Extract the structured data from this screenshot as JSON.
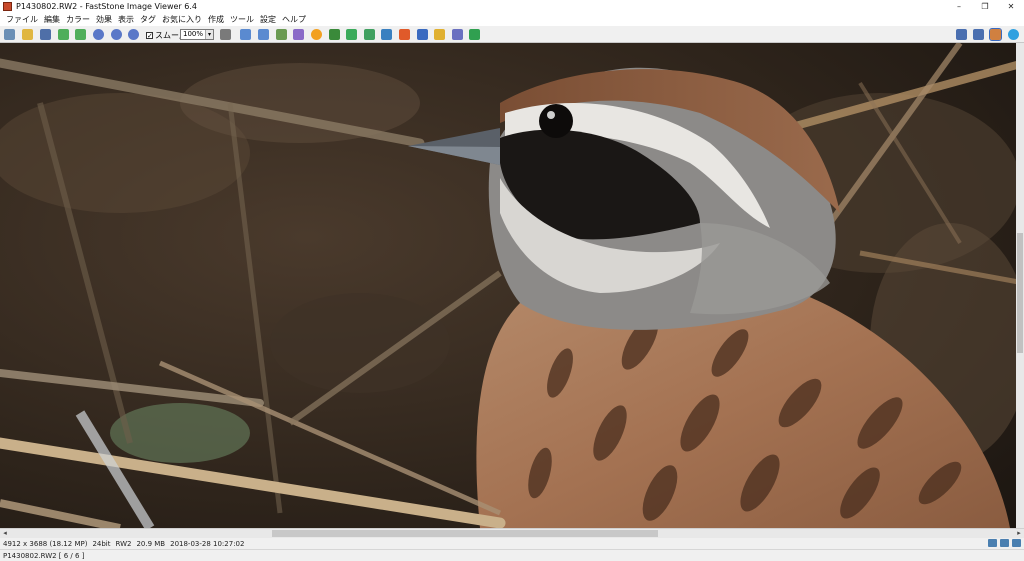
{
  "window": {
    "title": "P1430802.RW2 - FastStone Image Viewer 6.4",
    "minimize": "–",
    "restore": "❐",
    "close": "✕"
  },
  "menu": [
    "ファイル",
    "編集",
    "カラー",
    "効果",
    "表示",
    "タグ",
    "お気に入り",
    "作成",
    "ツール",
    "設定",
    "ヘルプ"
  ],
  "toolbar": {
    "smooth_label": "スムーズ",
    "smooth_checked": "✓",
    "zoom_value": "100%",
    "zoom_arrow": "▾",
    "left_icons": [
      {
        "name": "browser-icon",
        "color": "#6b8fb5"
      },
      {
        "name": "open-folder-icon",
        "color": "#e0b640"
      },
      {
        "name": "save-icon",
        "color": "#4f6fa8"
      },
      {
        "name": "previous-image-icon",
        "color": "#4fae5a"
      },
      {
        "name": "next-image-icon",
        "color": "#4fae5a"
      },
      {
        "name": "zoom-in-icon",
        "color": "#5a78c8"
      },
      {
        "name": "zoom-out-icon",
        "color": "#5a78c8"
      },
      {
        "name": "actual-size-icon",
        "color": "#5a78c8"
      }
    ],
    "right_icons": [
      {
        "name": "hand-tool-icon",
        "color": "#7a7a7a"
      },
      {
        "name": "rotate-left-icon",
        "color": "#5a8ad0"
      },
      {
        "name": "rotate-right-icon",
        "color": "#5a8ad0"
      },
      {
        "name": "crop-icon",
        "color": "#6a9a52"
      },
      {
        "name": "resize-icon",
        "color": "#8a6ac8"
      },
      {
        "name": "color-adjust-icon",
        "color": "#f2a020"
      },
      {
        "name": "red-eye-icon",
        "color": "#3a8a3a"
      },
      {
        "name": "email-icon",
        "color": "#3aaa5a"
      },
      {
        "name": "slideshow-icon",
        "color": "#40a060"
      },
      {
        "name": "compare-icon",
        "color": "#3a80c0"
      },
      {
        "name": "draw-icon",
        "color": "#e05a2a"
      },
      {
        "name": "print-icon",
        "color": "#3a6ac0"
      },
      {
        "name": "scan-icon",
        "color": "#e0b030"
      },
      {
        "name": "wallpaper-icon",
        "color": "#6a70c0"
      },
      {
        "name": "settings-icon",
        "color": "#30a050"
      }
    ],
    "far_right_icons": [
      {
        "name": "thumbnail-view-icon",
        "color": "#4a6fb0"
      },
      {
        "name": "fullscreen-icon",
        "color": "#4a6fb0"
      },
      {
        "name": "image-view-icon",
        "color": "#d08040"
      },
      {
        "name": "help-icon",
        "color": "#30a0e0"
      }
    ]
  },
  "status": {
    "dimensions": "4912 x 3688 (18.12 MP)",
    "bitdepth": "24bit",
    "format": "RW2",
    "filesize": "20.9 MB",
    "datetime": "2018-03-28 10:27:02",
    "file_position": "P1430802.RW2 [ 6 / 6 ]"
  },
  "scroll": {
    "left_arrow": "◂",
    "right_arrow": "▸"
  }
}
